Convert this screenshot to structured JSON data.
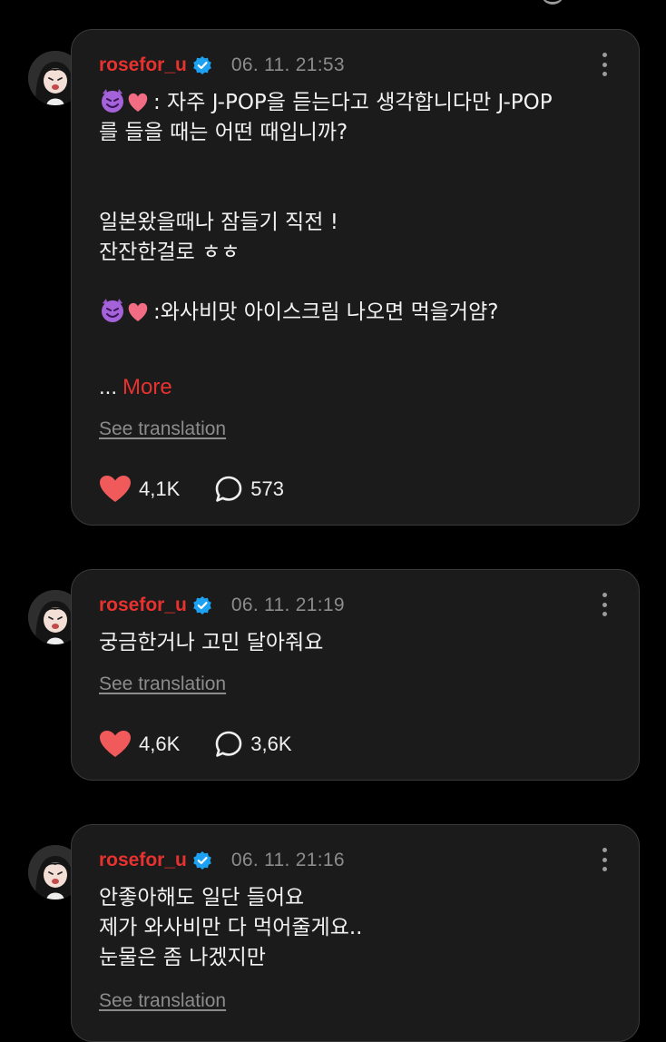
{
  "colors": {
    "background": "#000000",
    "card": "#1b1b1b",
    "card_border": "#3a3a3a",
    "username": "#e8322f",
    "more_link": "#e8322f",
    "heart": "#f05a5a",
    "verified_badge": "#1da1f2",
    "meta_text": "#8c8c8c"
  },
  "icons": {
    "verified": "verified-check-icon",
    "more": "three-dot-menu-icon",
    "like": "heart-icon",
    "comment": "speech-bubble-icon",
    "emoji_devil": "smiling-devil-emoji",
    "emoji_heart": "pink-heart-emoji"
  },
  "posts": [
    {
      "username": "rosefor_u",
      "timestamp": "06. 11. 21:53",
      "lines": [
        ": 자주 J-POP을 듣는다고 생각합니다만 J-POP",
        "를 들을 때는 어떤 때입니까?",
        "",
        "",
        "일본왔을때나 잠들기 직전 !",
        "잔잔한걸로 ㅎㅎ",
        "",
        ":와사비맛 아이스크림 나오면 먹을거얌?"
      ],
      "ellipsis": "...",
      "more_label": "More",
      "translate_label": "See translation",
      "likes": "4,1K",
      "comments": "573"
    },
    {
      "username": "rosefor_u",
      "timestamp": "06. 11. 21:19",
      "lines": [
        "궁금한거나 고민 달아줘요"
      ],
      "translate_label": "See translation",
      "likes": "4,6K",
      "comments": "3,6K"
    },
    {
      "username": "rosefor_u",
      "timestamp": "06. 11. 21:16",
      "lines": [
        "안좋아해도 일단 들어요",
        "제가 와사비만 다 먹어줄게요..",
        "눈물은 좀 나겠지만"
      ],
      "translate_label": "See translation"
    }
  ]
}
